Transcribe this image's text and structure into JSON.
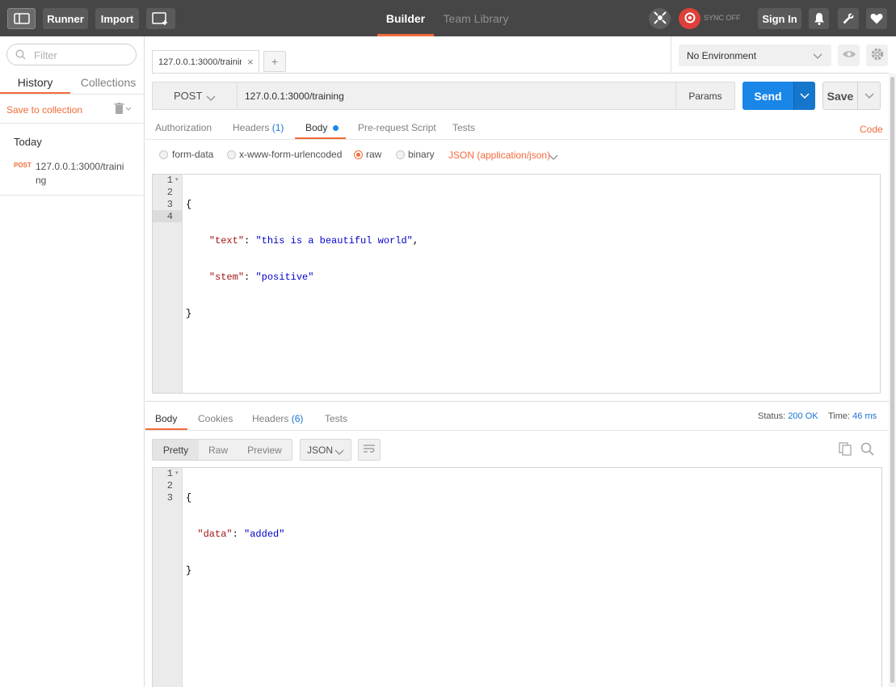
{
  "topbar": {
    "runner_label": "Runner",
    "import_label": "Import",
    "builder_tab": "Builder",
    "team_library_tab": "Team Library",
    "sync_status": "SYNC OFF",
    "sign_in_label": "Sign In"
  },
  "sidebar": {
    "filter_placeholder": "Filter",
    "tabs": [
      "History",
      "Collections"
    ],
    "save_to_collection": "Save to collection",
    "group_title": "Today",
    "history_items": [
      {
        "method": "POST",
        "url_line1": "127.0.0.1:3000/traini",
        "url_line2": "ng"
      }
    ]
  },
  "request_tab": {
    "label": "127.0.0.1:3000/trainin",
    "close_icon": "close-icon",
    "add_label": "+"
  },
  "environment": {
    "selected": "No Environment"
  },
  "request": {
    "method": "POST",
    "url": "127.0.0.1:3000/training",
    "params_label": "Params",
    "send_label": "Send",
    "save_label": "Save"
  },
  "request_tabs": {
    "authorization": "Authorization",
    "headers": "Headers",
    "headers_count": "(1)",
    "body": "Body",
    "prerequest": "Pre-request Script",
    "tests": "Tests",
    "code_link": "Code"
  },
  "body_modes": {
    "form_data": "form-data",
    "urlencoded": "x-www-form-urlencoded",
    "raw": "raw",
    "binary": "binary",
    "content_type": "JSON (application/json)",
    "selected": "raw"
  },
  "request_body": {
    "line_numbers": [
      "1",
      "2",
      "3",
      "4"
    ],
    "lines": {
      "l1": "{",
      "l2_key": "\"text\"",
      "l2_value": "\"this is a beautiful world\"",
      "l3_key": "\"stem\"",
      "l3_value": "\"positive\"",
      "l4": "}"
    }
  },
  "response_tabs": {
    "body": "Body",
    "cookies": "Cookies",
    "headers": "Headers",
    "headers_count": "(6)",
    "tests": "Tests",
    "status_label": "Status:",
    "status_value": "200 OK",
    "time_label": "Time:",
    "time_value": "46 ms"
  },
  "response_view": {
    "pretty": "Pretty",
    "raw": "Raw",
    "preview": "Preview",
    "format": "JSON"
  },
  "response_body": {
    "line_numbers": [
      "1",
      "2",
      "3"
    ],
    "lines": {
      "l1": "{",
      "l2_key": "\"data\"",
      "l2_value": "\"added\"",
      "l3": "}"
    }
  },
  "colors": {
    "topbar": "#464646",
    "accent_orange": "#f26b3a",
    "send_blue": "#1a86e8",
    "link_blue": "#1a73d4"
  }
}
